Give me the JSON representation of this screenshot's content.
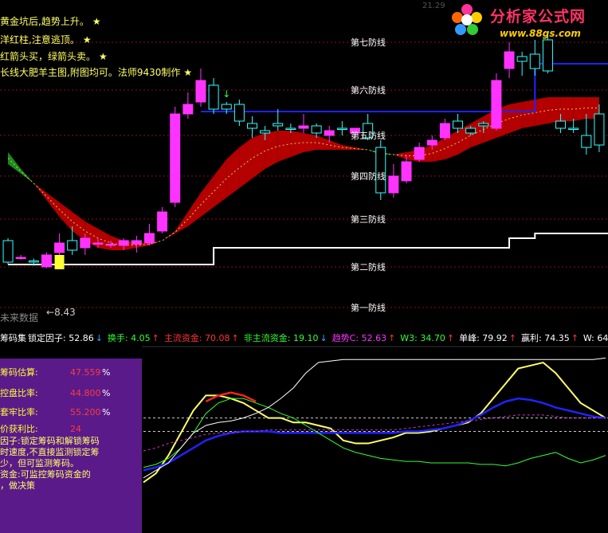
{
  "logo": {
    "main": "分析家公式网",
    "url": "www.88gs.com"
  },
  "top_number": "21.29",
  "notes": [
    {
      "text": "黄金坑后,趋势上升。",
      "star": "★"
    },
    {
      "text": "洋红柱,注意逃顶。",
      "star": "★"
    },
    {
      "text": "红箭头买，绿箭头卖。",
      "star": "★"
    },
    {
      "text": "长线大肥羊主图,附图均可。法师9430制作",
      "star": "★"
    }
  ],
  "defense_lines": [
    "第七防线",
    "第六防线",
    "第五防线",
    "第四防线",
    "第三防线",
    "第二防线",
    "第一防线"
  ],
  "future_label": "未来数据",
  "low_marker": "8.43",
  "indicator_bar": [
    {
      "text": "筹码集",
      "color": "#ffffff"
    },
    {
      "text": "锁定因子: 52.86",
      "color": "#ffffff"
    },
    {
      "text": "↓",
      "color": "#33aaff"
    },
    {
      "text": "换手: 4.05",
      "color": "#33ff33"
    },
    {
      "text": "↑",
      "color": "#ff3333"
    },
    {
      "text": "主流资金: 70.08",
      "color": "#ff3333"
    },
    {
      "text": "↑",
      "color": "#ff3333"
    },
    {
      "text": "非主流资金: 19.10",
      "color": "#33ff33"
    },
    {
      "text": "↓",
      "color": "#33aaff"
    },
    {
      "text": "趋势C: 52.63",
      "color": "#ff33ff"
    },
    {
      "text": "↑",
      "color": "#ff3333"
    },
    {
      "text": "W3: 34.70",
      "color": "#33ff33"
    },
    {
      "text": "↑",
      "color": "#ff3333"
    },
    {
      "text": "单峰: 79.92",
      "color": "#ffffff"
    },
    {
      "text": "↑",
      "color": "#ff3333"
    },
    {
      "text": "赢利: 74.35",
      "color": "#ffffff"
    },
    {
      "text": "↑",
      "color": "#ff3333"
    },
    {
      "text": "W: 64.",
      "color": "#ffffff"
    }
  ],
  "info_panel": {
    "stats": [
      {
        "label": "筹码估算:",
        "value": "47.559",
        "pct": "%"
      },
      {
        "label": "控盘比率:",
        "value": "44.800",
        "pct": "%"
      },
      {
        "label": "套牢比率:",
        "value": "55.200",
        "pct": "%"
      },
      {
        "label": "价获利比:",
        "value": "24",
        "pct": ""
      }
    ],
    "description": [
      {
        "text": "因子:锁定筹码和解锁筹码",
        "color": "#ffff66"
      },
      {
        "text": "时速度,不直接监测锁定筹",
        "color": "#ffff66"
      },
      {
        "text": "少，但可监测筹码。",
        "color": "#ffff66"
      },
      {
        "text": "资金:可监控筹码资金的",
        "color": "#ffff66"
      },
      {
        "text": "，做决策",
        "color": "#ffff66"
      }
    ]
  },
  "colors": {
    "bull_candle": "#ff33ff",
    "bear_candle": "#33ffff",
    "red_band": "#b40000",
    "green_band": "#1a8c1a",
    "blue_line": "#2222ff",
    "white_line": "#ffffff"
  },
  "chart_data": [
    {
      "type": "candlestick",
      "title": "",
      "candles": [
        {
          "o": 9.6,
          "h": 9.7,
          "l": 8.6,
          "c": 8.7
        },
        {
          "o": 8.9,
          "h": 9.0,
          "l": 8.8,
          "c": 8.9
        },
        {
          "o": 8.75,
          "h": 8.85,
          "l": 8.55,
          "c": 8.7
        },
        {
          "o": 8.5,
          "h": 9.1,
          "l": 8.45,
          "c": 9.0
        },
        {
          "o": 9.1,
          "h": 9.9,
          "l": 8.9,
          "c": 9.5
        },
        {
          "o": 9.6,
          "h": 10.2,
          "l": 9.0,
          "c": 9.2
        },
        {
          "o": 9.3,
          "h": 9.9,
          "l": 9.0,
          "c": 9.7
        },
        {
          "o": 9.5,
          "h": 9.7,
          "l": 9.3,
          "c": 9.5
        },
        {
          "o": 9.4,
          "h": 9.6,
          "l": 9.3,
          "c": 9.45
        },
        {
          "o": 9.4,
          "h": 9.7,
          "l": 9.2,
          "c": 9.6
        },
        {
          "o": 9.45,
          "h": 9.8,
          "l": 9.1,
          "c": 9.6
        },
        {
          "o": 9.5,
          "h": 10.3,
          "l": 9.4,
          "c": 9.9
        },
        {
          "o": 10.0,
          "h": 11.0,
          "l": 9.9,
          "c": 10.8
        },
        {
          "o": 11.2,
          "h": 15.2,
          "l": 11.0,
          "c": 14.9
        },
        {
          "o": 14.9,
          "h": 15.8,
          "l": 14.7,
          "c": 15.3
        },
        {
          "o": 15.4,
          "h": 16.8,
          "l": 15.2,
          "c": 16.3
        },
        {
          "o": 16.1,
          "h": 16.4,
          "l": 14.9,
          "c": 15.1
        },
        {
          "o": 15.3,
          "h": 15.4,
          "l": 14.9,
          "c": 15.1
        },
        {
          "o": 15.3,
          "h": 15.5,
          "l": 14.4,
          "c": 14.6
        },
        {
          "o": 14.5,
          "h": 14.8,
          "l": 13.9,
          "c": 14.3
        },
        {
          "o": 14.2,
          "h": 14.4,
          "l": 13.8,
          "c": 14.1
        },
        {
          "o": 14.5,
          "h": 15.1,
          "l": 14.2,
          "c": 14.4
        },
        {
          "o": 14.3,
          "h": 14.5,
          "l": 14.1,
          "c": 14.25
        },
        {
          "o": 14.3,
          "h": 14.9,
          "l": 14.1,
          "c": 14.4
        },
        {
          "o": 14.4,
          "h": 14.5,
          "l": 13.9,
          "c": 14.1
        },
        {
          "o": 14.0,
          "h": 14.4,
          "l": 13.7,
          "c": 14.2
        },
        {
          "o": 14.3,
          "h": 14.6,
          "l": 14.0,
          "c": 14.25
        },
        {
          "o": 14.1,
          "h": 14.3,
          "l": 13.8,
          "c": 14.3
        },
        {
          "o": 14.5,
          "h": 14.9,
          "l": 13.8,
          "c": 13.9
        },
        {
          "o": 13.5,
          "h": 13.8,
          "l": 11.3,
          "c": 11.6
        },
        {
          "o": 11.6,
          "h": 12.8,
          "l": 11.4,
          "c": 12.3
        },
        {
          "o": 12.1,
          "h": 13.2,
          "l": 12.0,
          "c": 12.9
        },
        {
          "o": 13.0,
          "h": 13.7,
          "l": 12.9,
          "c": 13.5
        },
        {
          "o": 13.6,
          "h": 14.0,
          "l": 13.4,
          "c": 13.8
        },
        {
          "o": 13.9,
          "h": 14.7,
          "l": 13.8,
          "c": 14.5
        },
        {
          "o": 14.6,
          "h": 14.9,
          "l": 14.1,
          "c": 14.3
        },
        {
          "o": 14.3,
          "h": 14.4,
          "l": 14.0,
          "c": 14.1
        },
        {
          "o": 14.5,
          "h": 14.6,
          "l": 14.1,
          "c": 14.4
        },
        {
          "o": 14.3,
          "h": 16.6,
          "l": 14.2,
          "c": 16.3
        },
        {
          "o": 16.8,
          "h": 17.9,
          "l": 16.4,
          "c": 17.5
        },
        {
          "o": 17.3,
          "h": 17.5,
          "l": 16.5,
          "c": 17.1
        },
        {
          "o": 17.4,
          "h": 18.0,
          "l": 16.5,
          "c": 16.8
        },
        {
          "o": 18.0,
          "h": 18.3,
          "l": 16.6,
          "c": 16.7
        },
        {
          "o": 14.6,
          "h": 14.9,
          "l": 14.1,
          "c": 14.3
        },
        {
          "o": 14.3,
          "h": 14.7,
          "l": 14.1,
          "c": 14.25
        },
        {
          "o": 14.0,
          "h": 14.9,
          "l": 13.2,
          "c": 13.5
        },
        {
          "o": 14.9,
          "h": 15.3,
          "l": 13.3,
          "c": 13.6
        }
      ],
      "defense_line_values": [
        17.9,
        15.9,
        14.0,
        12.3,
        10.5,
        8.5,
        6.8
      ],
      "annotations": [
        {
          "text": "8.43",
          "value": 8.43
        }
      ]
    },
    {
      "type": "line",
      "title": "",
      "series": [
        {
          "name": "",
          "color": "#ffff66",
          "values": [
            12,
            18,
            30,
            45,
            60,
            70,
            70,
            68,
            65,
            60,
            55,
            55,
            52,
            52,
            50,
            48,
            40,
            38,
            38,
            40,
            42,
            45,
            45,
            46,
            48,
            50,
            52,
            58,
            68,
            78,
            88,
            90,
            92,
            85,
            75,
            65,
            60,
            55
          ]
        },
        {
          "name": "",
          "color": "#2222ff",
          "values": [
            20,
            22,
            25,
            30,
            35,
            40,
            43,
            45,
            46,
            46,
            46,
            45,
            45,
            45,
            45,
            45,
            45,
            45,
            45,
            45,
            45,
            46,
            46,
            47,
            48,
            50,
            53,
            57,
            62,
            66,
            68,
            67,
            65,
            62,
            60,
            58,
            56,
            55
          ]
        },
        {
          "name": "",
          "color": "#33ff33",
          "values": [
            22,
            24,
            28,
            35,
            45,
            58,
            65,
            68,
            68,
            65,
            62,
            58,
            55,
            50,
            45,
            40,
            35,
            32,
            30,
            28,
            27,
            26,
            26,
            25,
            25,
            25,
            25,
            24,
            24,
            23,
            25,
            28,
            30,
            32,
            28,
            25,
            27,
            30
          ]
        },
        {
          "name": "",
          "color": "#ffffff",
          "values": [
            15,
            20,
            25,
            35,
            45,
            50,
            52,
            53,
            55,
            58,
            62,
            68,
            75,
            85,
            92,
            93,
            94,
            94,
            94,
            94,
            94,
            94,
            94,
            94,
            94,
            94,
            94,
            94,
            94,
            94,
            94,
            94,
            94,
            94,
            94,
            94,
            94,
            95
          ]
        },
        {
          "name": "",
          "color": "#cc33cc",
          "values": [
            33,
            35,
            38,
            40,
            42,
            44,
            45,
            45,
            46,
            46,
            47,
            47,
            47,
            47,
            47,
            47,
            47,
            47,
            47,
            47,
            47,
            48,
            49,
            50,
            51,
            52,
            53,
            54,
            55,
            56,
            57,
            57,
            57,
            56,
            55,
            55,
            55,
            55
          ]
        },
        {
          "name": "",
          "color": "#ff2222",
          "values": [
            null,
            null,
            null,
            null,
            null,
            66,
            70,
            72,
            70,
            66,
            null,
            null,
            null,
            null,
            null,
            null,
            null,
            null,
            null,
            null,
            null,
            null,
            null,
            null,
            null,
            null,
            null,
            null,
            null,
            null,
            null,
            null,
            null,
            null,
            null,
            null,
            null,
            null
          ]
        }
      ],
      "ylim": [
        0,
        100
      ],
      "reference_lines": [
        46,
        55
      ]
    }
  ]
}
